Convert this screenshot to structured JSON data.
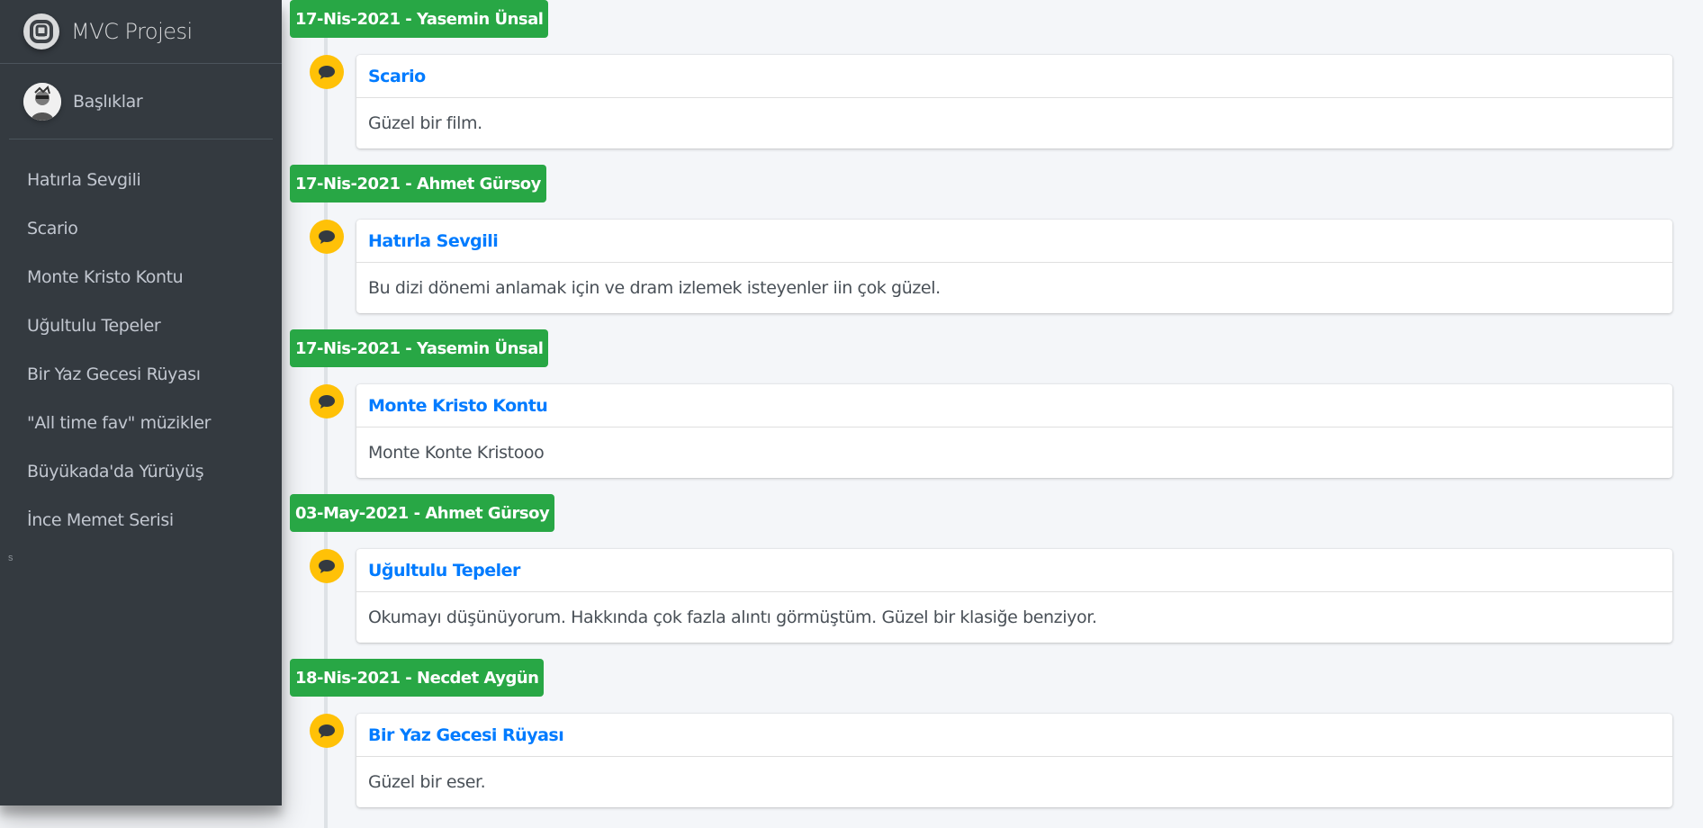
{
  "brand": {
    "title": "MVC Projesi",
    "icon": "letter-a-logo"
  },
  "user_panel": {
    "name": "Başlıklar",
    "avatar_icon": "user-avatar"
  },
  "sidebar": {
    "items": [
      {
        "label": "Hatırla Sevgili"
      },
      {
        "label": "Scario"
      },
      {
        "label": "Monte Kristo Kontu"
      },
      {
        "label": "Uğultulu Tepeler"
      },
      {
        "label": "Bir Yaz Gecesi Rüyası"
      },
      {
        "label": "\"All time fav\" müzikler"
      },
      {
        "label": "Büyükada'da Yürüyüş"
      },
      {
        "label": "İnce Memet Serisi"
      }
    ],
    "stray_text": "s"
  },
  "timeline": {
    "entries": [
      {
        "label": "17-Nis-2021 - Yasemin Ünsal",
        "title": "Scario",
        "body": "Güzel bir film."
      },
      {
        "label": "17-Nis-2021 - Ahmet Gürsoy",
        "title": "Hatırla Sevgili",
        "body": "Bu dizi dönemi anlamak için ve dram izlemek isteyenler iin çok güzel."
      },
      {
        "label": "17-Nis-2021 - Yasemin Ünsal",
        "title": "Monte Kristo Kontu",
        "body": "Monte Konte Kristooo"
      },
      {
        "label": "03-May-2021 - Ahmet Gürsoy",
        "title": "Uğultulu Tepeler",
        "body": "Okumayı düşünüyorum. Hakkında çok fazla alıntı görmüştüm. Güzel bir klasiğe benziyor."
      },
      {
        "label": "18-Nis-2021 - Necdet Aygün",
        "title": "Bir Yaz Gecesi Rüyası",
        "body": "Güzel bir eser."
      }
    ]
  },
  "colors": {
    "sidebar_bg": "#343a40",
    "label_green": "#28a745",
    "bubble_yellow": "#ffc107",
    "link_blue": "#007bff",
    "page_bg": "#f4f6f9"
  },
  "icons": {
    "timeline_bubble": "comment-icon"
  }
}
